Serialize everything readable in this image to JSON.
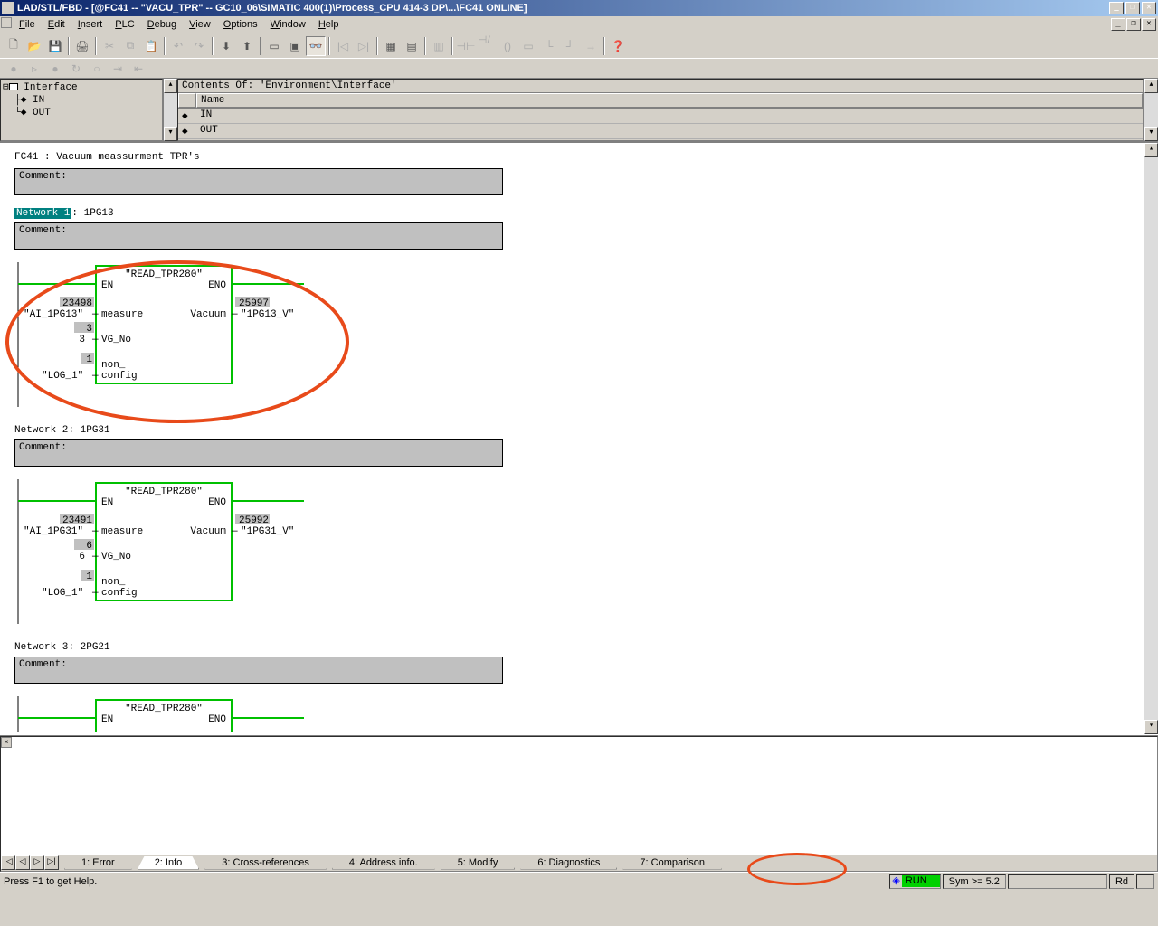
{
  "window": {
    "title": "LAD/STL/FBD - [@FC41 -- \"VACU_TPR\" -- GC10_06\\SIMATIC 400(1)\\Process_CPU 414-3 DP\\...\\FC41  ONLINE]"
  },
  "menu": {
    "file": "File",
    "edit": "Edit",
    "insert": "Insert",
    "plc": "PLC",
    "debug": "Debug",
    "view": "View",
    "options": "Options",
    "window": "Window",
    "help": "Help"
  },
  "tree": {
    "root": "Interface",
    "in": "IN",
    "out": "OUT"
  },
  "interface_panel": {
    "contents_label": "Contents Of: 'Environment\\Interface'",
    "col_name": "Name",
    "rows": [
      "IN",
      "OUT"
    ]
  },
  "ladder": {
    "fc_title": "FC41 : Vacuum meassurment TPR's",
    "comment_label": "Comment:",
    "networks": [
      {
        "num": "Network 1",
        "name": "1PG13",
        "block": {
          "title": "\"READ_TPR280\"",
          "en": "EN",
          "eno": "ENO",
          "ports_left": [
            {
              "val": "23498",
              "tag": "\"AI_1PG13\"",
              "pin": "measure"
            },
            {
              "val": "3",
              "tag": "3",
              "pin": "VG_No"
            },
            {
              "val": "1",
              "tag": "\"LOG_1\"",
              "pin": "non_\nconfig"
            }
          ],
          "ports_right": [
            {
              "pin": "Vacuum",
              "val": "25997",
              "tag": "\"1PG13_V\""
            }
          ]
        }
      },
      {
        "num": "Network 2",
        "name": "1PG31",
        "block": {
          "title": "\"READ_TPR280\"",
          "en": "EN",
          "eno": "ENO",
          "ports_left": [
            {
              "val": "23491",
              "tag": "\"AI_1PG31\"",
              "pin": "measure"
            },
            {
              "val": "6",
              "tag": "6",
              "pin": "VG_No"
            },
            {
              "val": "1",
              "tag": "\"LOG_1\"",
              "pin": "non_\nconfig"
            }
          ],
          "ports_right": [
            {
              "pin": "Vacuum",
              "val": "25992",
              "tag": "\"1PG31_V\""
            }
          ]
        }
      },
      {
        "num": "Network 3",
        "name": "2PG21",
        "block": {
          "title": "\"READ_TPR280\"",
          "en": "EN",
          "eno": "ENO"
        }
      }
    ]
  },
  "output_tabs": {
    "t1": "1: Error",
    "t2": "2: Info",
    "t3": "3: Cross-references",
    "t4": "4: Address info.",
    "t5": "5: Modify",
    "t6": "6: Diagnostics",
    "t7": "7: Comparison"
  },
  "status": {
    "help": "Press F1 to get Help.",
    "run": "RUN",
    "sym": "Sym >= 5.2",
    "rd": "Rd"
  }
}
